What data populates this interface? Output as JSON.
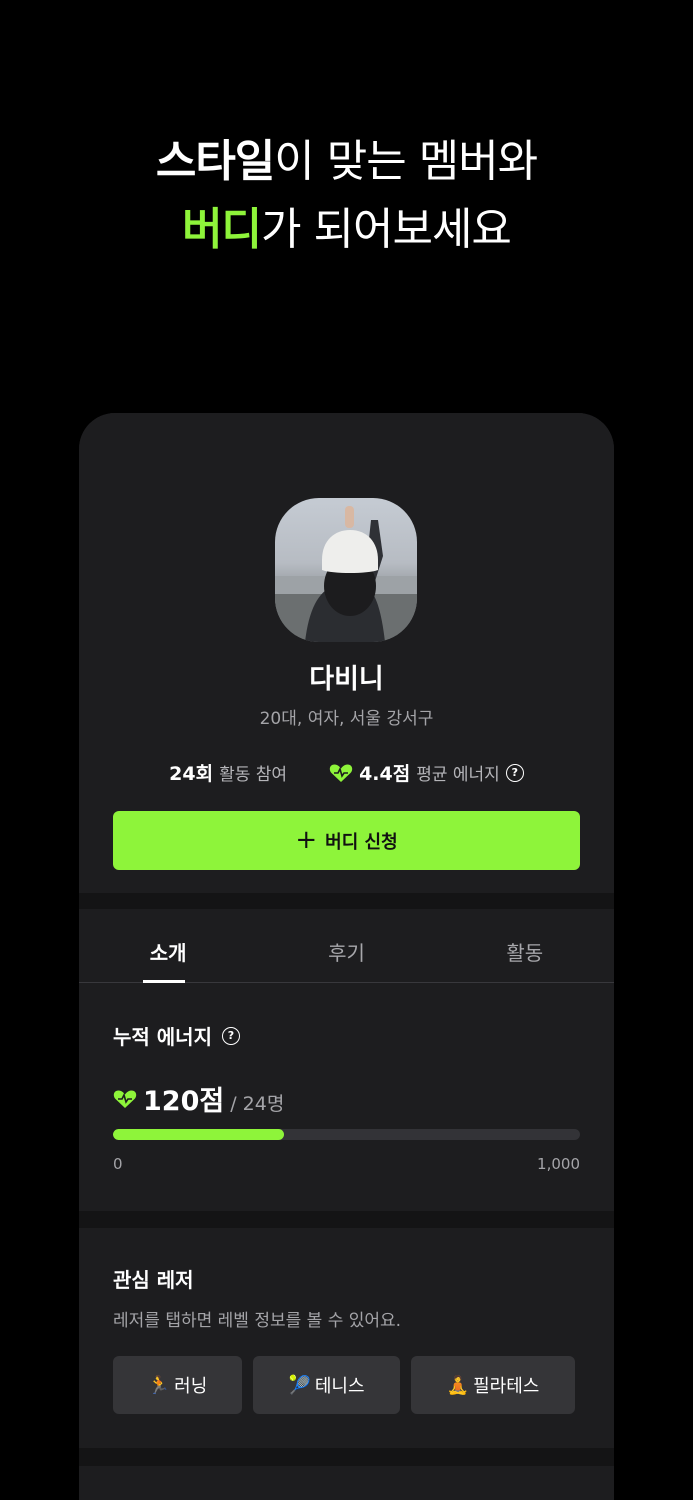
{
  "headline": {
    "line1_bold": "스타일",
    "line1_rest": "이 맞는 멤버와",
    "line2_accent": "버디",
    "line2_rest": "가 되어보세요"
  },
  "profile": {
    "name": "다비니",
    "meta": "20대, 여자, 서울 강서구",
    "activity_count": "24회",
    "activity_label": "활동 참여",
    "energy_score": "4.4점",
    "energy_label": "평균 에너지",
    "help_glyph": "?"
  },
  "buddy_button": {
    "plus": "+",
    "label": "버디 신청"
  },
  "tabs": [
    {
      "label": "소개",
      "active": true
    },
    {
      "label": "후기",
      "active": false
    },
    {
      "label": "활동",
      "active": false
    }
  ],
  "energy": {
    "title": "누적 에너지",
    "score": "120점",
    "members": "/ 24명",
    "progress_fraction": 0.367,
    "axis_min": "0",
    "axis_max": "1,000"
  },
  "leisure": {
    "title": "관심 레저",
    "subtitle": "레저를 탭하면 레벨 정보를 볼 수 있어요.",
    "chips": [
      {
        "emoji": "🏃",
        "label": "러닝"
      },
      {
        "emoji": "🎾",
        "label": "테니스"
      },
      {
        "emoji": "🧘",
        "label": "필라테스"
      }
    ]
  },
  "colors": {
    "accent": "#8ef43a",
    "background": "#000000",
    "card": "#1d1d1f",
    "separator": "#141415",
    "chip": "#353538"
  },
  "icons": {
    "energy": "green-heart-icon",
    "help": "question-circle-icon"
  }
}
